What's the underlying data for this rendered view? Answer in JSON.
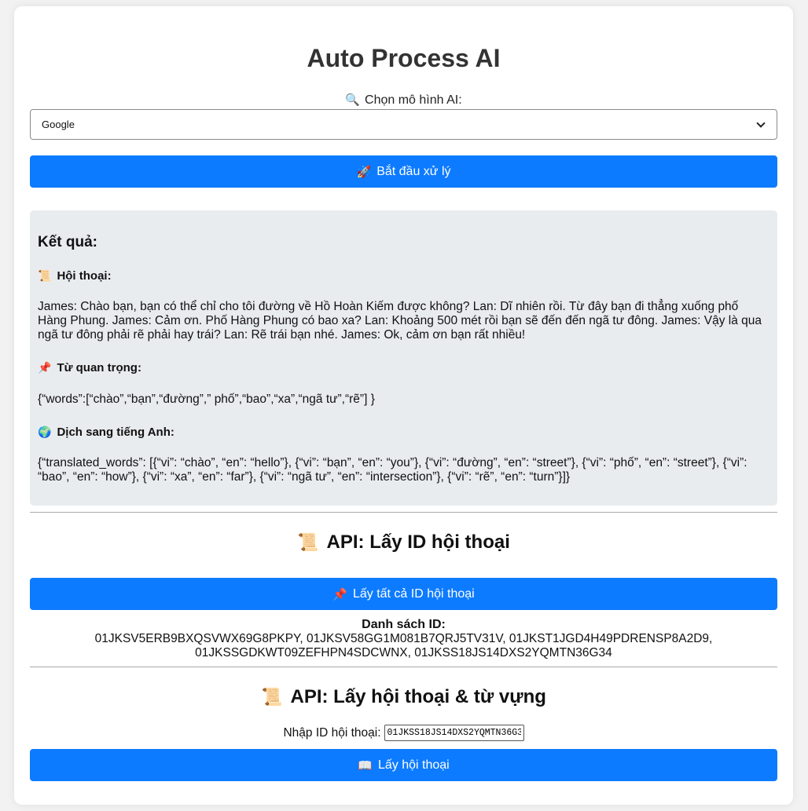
{
  "app": {
    "title": "Auto Process AI"
  },
  "model": {
    "label": "Chọn mô hình AI:",
    "selected": "Google"
  },
  "start_button": {
    "label": "Bắt đầu xử lý"
  },
  "result": {
    "heading": "Kết quả:",
    "conversation_heading": "Hội thoại:",
    "conversation": "James: Chào bạn, bạn có thể chỉ cho tôi đường về Hồ Hoàn Kiếm được không? Lan: Dĩ nhiên rồi. Từ đây bạn đi thẳng xuống phố Hàng Phung. James: Cảm ơn. Phố Hàng Phung có bao xa? Lan: Khoảng 500 mét rồi bạn sẽ đến đến ngã tư đông. James: Vậy là qua ngã tư đông phải rẽ phải hay trái? Lan: Rẽ trái bạn nhé. James: Ok, cảm ơn bạn rất nhiều!",
    "keywords_heading": "Từ quan trọng:",
    "keywords": "{“words”:[“chào”,“bạn”,“đường”,” phố”,“bao”,“xa”,“ngã tư”,“rẽ”] }",
    "translation_heading": "Dịch sang tiếng Anh:",
    "translation": "{“translated_words”: [{“vi”: “chào”, “en”: “hello”}, {“vi”: “bạn”, “en”: “you”}, {“vi”: “đường”, “en”: “street”}, {“vi”: “phố”, “en”: “street”}, {“vi”: “bao”, “en”: “how”}, {“vi”: “xa”, “en”: “far”}, {“vi”: “ngã tư”, “en”: “intersection”}, {“vi”: “rẽ”, “en”: “turn”}]}"
  },
  "api_ids": {
    "title": "API: Lấy ID hội thoại",
    "button_label": "Lấy tất cả ID hội thoại",
    "list_label": "Danh sách ID:",
    "list": "01JKSV5ERB9BXQSVWX69G8PKPY, 01JKSV58GG1M081B7QRJ5TV31V, 01JKST1JGD4H49PDRENSP8A2D9, 01JKSSGDKWT09ZEFHPN4SDCWNX, 01JKSS18JS14DXS2YQMTN36G34"
  },
  "api_conversation": {
    "title": "API: Lấy hội thoại & từ vựng",
    "input_label": "Nhập ID hội thoại:",
    "input_value": "01JKSS18JS14DXS2YQMTN36G34",
    "button_label": "Lấy hội thoại"
  },
  "icons": {
    "search": "🔍",
    "rocket": "🚀",
    "scroll": "📜",
    "pin": "📌",
    "globe": "🌍",
    "book": "📖"
  },
  "colors": {
    "primary": "#0d7bff",
    "result_bg": "#e9ecef",
    "page_bg": "#f2f2f2"
  }
}
